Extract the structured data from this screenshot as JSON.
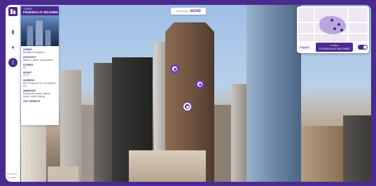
{
  "app": {
    "brand_prefix": "Powered by",
    "brand_name": "ocsio"
  },
  "panel": {
    "kicker": "TOWER",
    "title": "FIGUEROA AT WILSHIRE",
    "fields": [
      {
        "key": "Owner",
        "value": "Brookfield Properties"
      },
      {
        "key": "Architect",
        "value": "Albert C. Martin & Associates"
      },
      {
        "key": "Stories",
        "value": "53"
      },
      {
        "key": "Height",
        "value": "717 ft"
      },
      {
        "key": "Address",
        "value": "601 S Figueroa St, Los Angeles, CA"
      },
      {
        "key": "Amenities",
        "value": "Conference center, fitness center, retail & dining"
      }
    ],
    "link": "VISIT WEBSITE"
  },
  "rail": {
    "icons": [
      "building-icon",
      "location-pin-icon",
      "info-icon"
    ],
    "footer": "Powered by ocsio"
  },
  "minimap": {
    "chip": "Explore",
    "cta_title": "FIGUEROA AT WILSHIRE",
    "cta_sub": "Location",
    "accent": "#4b2a8f"
  },
  "colors": {
    "accent": "#4b2a8f",
    "marker": "#6a3fbf"
  }
}
